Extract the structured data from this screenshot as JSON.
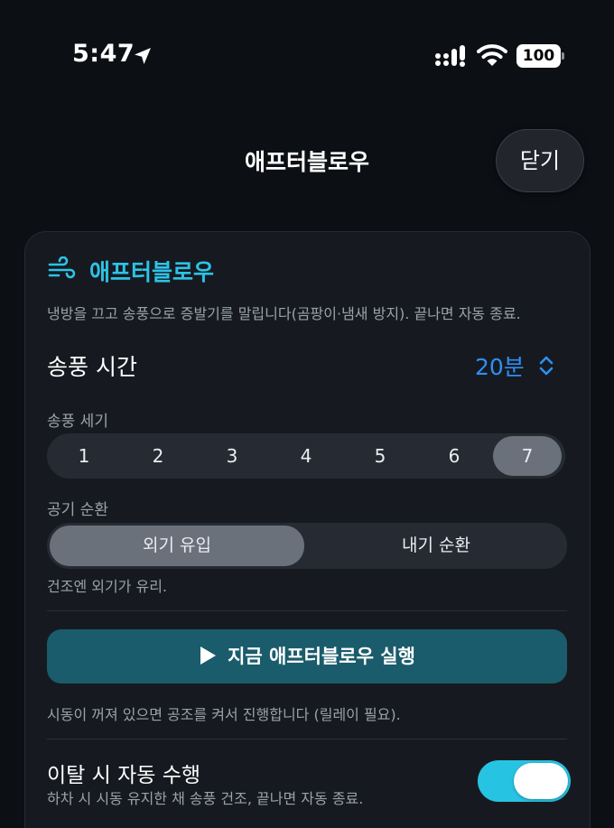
{
  "status_bar": {
    "time": "5:47",
    "battery": "100"
  },
  "nav": {
    "title": "애프터블로우",
    "close_label": "닫기"
  },
  "card": {
    "title": "애프터블로우",
    "title_icon": "wind-icon",
    "description": "냉방을 끄고 송풍으로 증발기를 말립니다(곰팡이·냄새 방지). 끝나면 자동 종료.",
    "duration": {
      "label": "송풍 시간",
      "value": "20분"
    },
    "fan_speed": {
      "label": "송풍 세기",
      "options": [
        "1",
        "2",
        "3",
        "4",
        "5",
        "6",
        "7"
      ],
      "selected": "7"
    },
    "air_circulation": {
      "label": "공기 순환",
      "options": [
        "외기 유입",
        "내기 순환"
      ],
      "selected": "외기 유입",
      "hint": "건조엔 외기가 유리."
    },
    "run_button": {
      "label": "지금 애프터블로우 실행",
      "icon": "play-icon",
      "hint": "시동이 꺼져 있으면 공조를 켜서 진행합니다 (릴레이 필요)."
    },
    "auto_run": {
      "title": "이탈 시 자동 수행",
      "description": "하차 시 시동 유지한 채 송풍 건조, 끝나면 자동 종료.",
      "enabled": true
    }
  },
  "colors": {
    "background": "#0c0f14",
    "accent_cyan": "#2dc3e6",
    "accent_blue": "#2f8ff5",
    "run_button": "#1a5c6b",
    "toggle_on": "#27c3e3"
  }
}
